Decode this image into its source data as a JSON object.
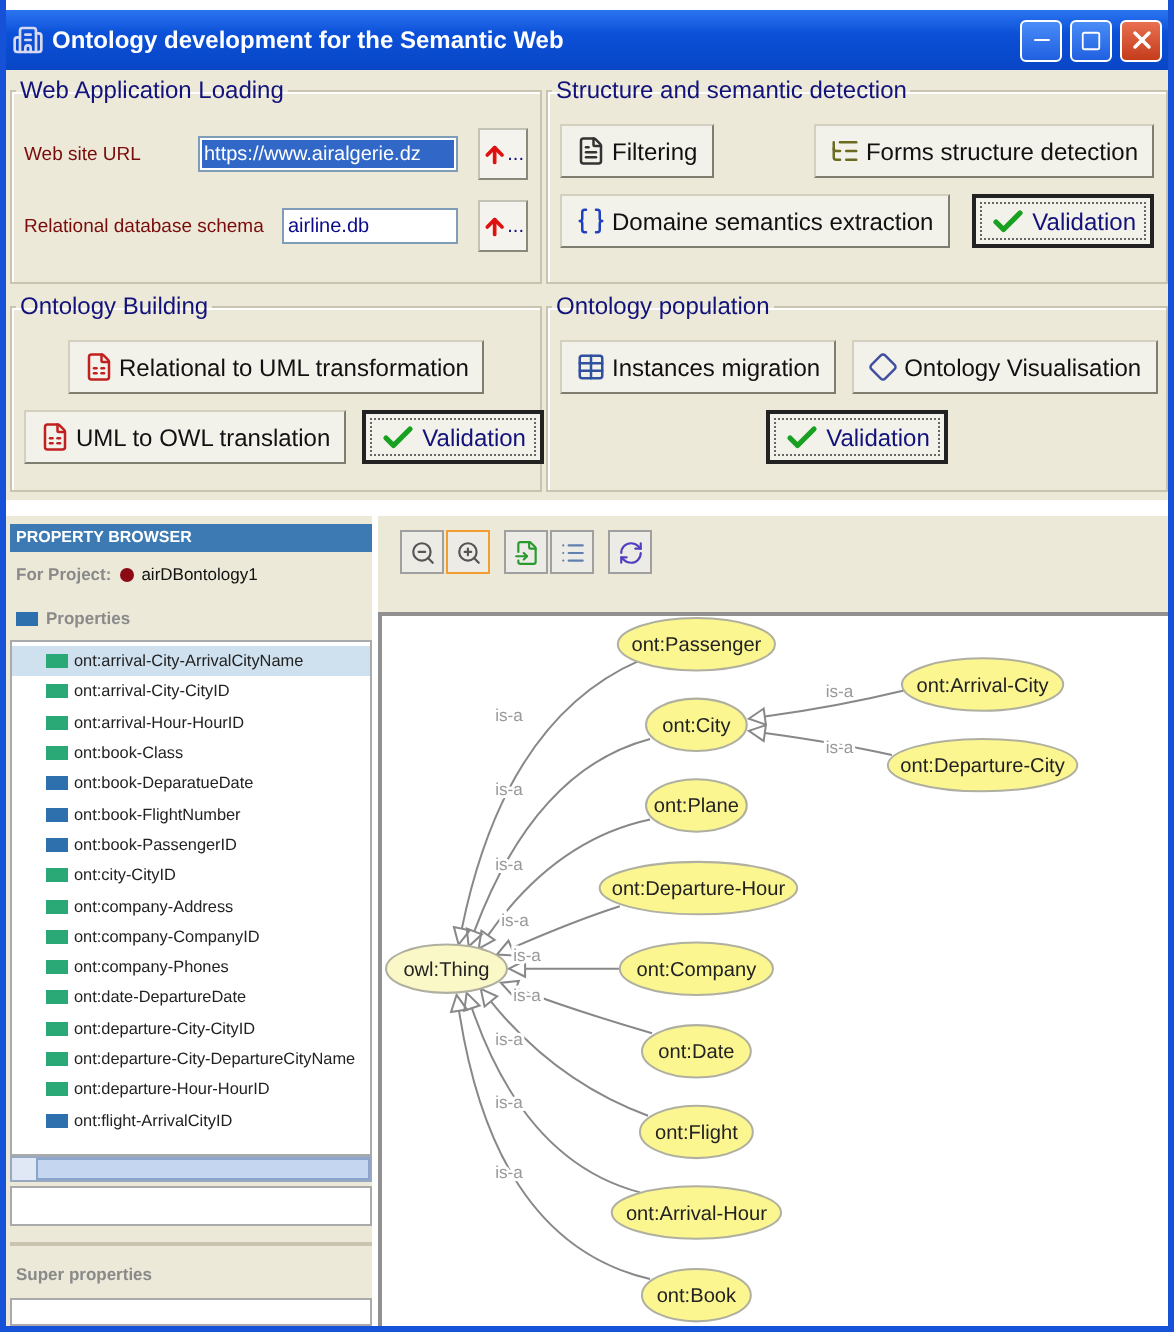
{
  "window": {
    "title": "Ontology development for the Semantic Web"
  },
  "loading": {
    "title": "Web Application Loading",
    "fields": [
      {
        "label": "Web site URL",
        "value": "https://www.airalgerie.dz",
        "text_selected": true,
        "browse": "..."
      },
      {
        "label": "Relational database schema",
        "value": "airline.db",
        "text_selected": false,
        "browse": "..."
      }
    ]
  },
  "sections": [
    {
      "title": "Structure and semantic detection",
      "rows": [
        [
          {
            "label": "Filtering",
            "kind": "filter"
          },
          {
            "label": "Forms structure detection",
            "kind": "forms"
          }
        ],
        [
          {
            "label": "Domaine semantics extraction",
            "kind": "semantics"
          },
          {
            "label": "Validation",
            "kind": "validate"
          }
        ]
      ]
    },
    {
      "title": "Ontology Building",
      "rows": [
        [
          {
            "label": "Relational to UML transformation",
            "kind": "transform"
          }
        ],
        [
          {
            "label": "UML to OWL translation",
            "kind": "transform"
          },
          {
            "label": "Validation",
            "kind": "validate"
          }
        ]
      ]
    },
    {
      "title": "Ontology population",
      "rows": [
        [
          {
            "label": "Instances migration",
            "kind": "instances"
          },
          {
            "label": "Ontology Visualisation",
            "kind": "visualise"
          }
        ],
        [
          {
            "label": "Validation",
            "kind": "validate"
          }
        ]
      ]
    }
  ],
  "property_browser": {
    "header": "PROPERTY BROWSER",
    "project_label": "For Project:",
    "project": "airDBontology1",
    "properties_title": "Properties",
    "super_title": "Super properties",
    "properties": [
      {
        "label": "ont:arrival-City-ArrivalCityName",
        "color": "#2aa876",
        "selected": true
      },
      {
        "label": "ont:arrival-City-CityID",
        "color": "#2aa876",
        "selected": false
      },
      {
        "label": "ont:arrival-Hour-HourID",
        "color": "#2aa876",
        "selected": false
      },
      {
        "label": "ont:book-Class",
        "color": "#2aa876",
        "selected": false
      },
      {
        "label": "ont:book-DeparatueDate",
        "color": "#2e6fae",
        "selected": false
      },
      {
        "label": "ont:book-FlightNumber",
        "color": "#2e6fae",
        "selected": false
      },
      {
        "label": "ont:book-PassengerID",
        "color": "#2e6fae",
        "selected": false
      },
      {
        "label": "ont:city-CityID",
        "color": "#2aa876",
        "selected": false
      },
      {
        "label": "ont:company-Address",
        "color": "#2aa876",
        "selected": false
      },
      {
        "label": "ont:company-CompanyID",
        "color": "#2aa876",
        "selected": false
      },
      {
        "label": "ont:company-Phones",
        "color": "#2aa876",
        "selected": false
      },
      {
        "label": "ont:date-DepartureDate",
        "color": "#2aa876",
        "selected": false
      },
      {
        "label": "ont:departure-City-CityID",
        "color": "#2aa876",
        "selected": false
      },
      {
        "label": "ont:departure-City-DepartureCityName",
        "color": "#2aa876",
        "selected": false
      },
      {
        "label": "ont:departure-Hour-HourID",
        "color": "#2aa876",
        "selected": false
      },
      {
        "label": "ont:flight-ArrivalCityID",
        "color": "#2e6fae",
        "selected": false
      }
    ]
  },
  "graph_toolbar": [
    {
      "kind": "zoom-out",
      "selected": false
    },
    {
      "kind": "zoom-in",
      "selected": true
    },
    {
      "kind": "export",
      "selected": false
    },
    {
      "kind": "list",
      "selected": false
    },
    {
      "kind": "refresh",
      "selected": false
    }
  ],
  "graph": {
    "label": "owl:Thing",
    "children": [
      {
        "label": "ont:Passenger",
        "edge": "is-a"
      },
      {
        "label": "ont:City",
        "edge": "is-a",
        "children": [
          {
            "label": "ont:Arrival-City",
            "edge": "is-a"
          },
          {
            "label": "ont:Departure-City",
            "edge": "is-a"
          }
        ]
      },
      {
        "label": "ont:Plane",
        "edge": "is-a"
      },
      {
        "label": "ont:Departure-Hour",
        "edge": "is-a"
      },
      {
        "label": "ont:Company",
        "edge": "is-a"
      },
      {
        "label": "ont:Date",
        "edge": "is-a"
      },
      {
        "label": "ont:Flight",
        "edge": "is-a"
      },
      {
        "label": "ont:Arrival-Hour",
        "edge": "is-a"
      },
      {
        "label": "ont:Book",
        "edge": "is-a"
      }
    ]
  }
}
